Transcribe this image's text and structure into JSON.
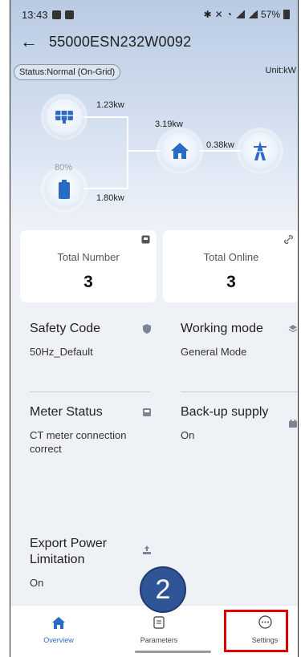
{
  "statusbar": {
    "time": "13:43",
    "battery": "57%"
  },
  "header": {
    "title": "55000ESN232W0092"
  },
  "status": {
    "text": "Status:Normal (On-Grid)",
    "unit": "Unit:kW"
  },
  "flow": {
    "pv_power": "1.23kw",
    "load_power": "3.19kw",
    "grid_power": "0.38kw",
    "battery_soc": "80%",
    "battery_power": "1.80kw"
  },
  "stats": {
    "total_number": {
      "label": "Total Number",
      "value": "3"
    },
    "total_online": {
      "label": "Total Online",
      "value": "3"
    }
  },
  "info": {
    "safety_code": {
      "title": "Safety Code",
      "value": "50Hz_Default"
    },
    "working_mode": {
      "title": "Working mode",
      "value": "General Mode"
    },
    "meter_status": {
      "title": "Meter Status",
      "value": "CT meter connection correct"
    },
    "backup_supply": {
      "title": "Back-up supply",
      "value": "On"
    },
    "export_limit": {
      "title": "Export Power Limitation",
      "value": "On"
    }
  },
  "badge": {
    "number": "2"
  },
  "nav": {
    "overview": "Overview",
    "parameters": "Parameters",
    "settings": "Settings"
  },
  "colors": {
    "accent": "#2a6bc7",
    "highlight": "#e00000",
    "badge": "#2f5597"
  }
}
